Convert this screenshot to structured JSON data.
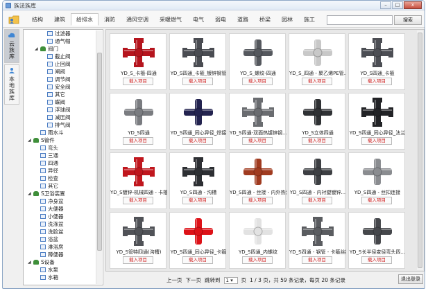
{
  "window": {
    "title": "族法族库",
    "minimize": "–",
    "maximize": "□",
    "close": "x"
  },
  "tabs": [
    "结构",
    "建筑",
    "给排水",
    "消防",
    "通风空调",
    "采暖燃气",
    "电气",
    "弱电",
    "道路",
    "桥梁",
    "园林",
    "施工"
  ],
  "active_tab": 2,
  "search": {
    "value": "",
    "placeholder": "",
    "button_label": "搜索"
  },
  "side_nav": [
    {
      "label": [
        "云",
        "族",
        "库"
      ],
      "active": true
    },
    {
      "label": [
        "本",
        "地",
        "族",
        "库"
      ],
      "active": false
    }
  ],
  "tree": [
    {
      "label": "过滤器",
      "level": 3,
      "type": "leaf",
      "expander": ""
    },
    {
      "label": "通气帽",
      "level": 3,
      "type": "leaf",
      "expander": ""
    },
    {
      "label": "阀门",
      "level": 2,
      "type": "folder",
      "expander": "◢"
    },
    {
      "label": "截止阀",
      "level": 3,
      "type": "leaf",
      "expander": ""
    },
    {
      "label": "止回阀",
      "level": 3,
      "type": "leaf",
      "expander": ""
    },
    {
      "label": "闸阀",
      "level": 3,
      "type": "leaf",
      "expander": ""
    },
    {
      "label": "调节阀",
      "level": 3,
      "type": "leaf",
      "expander": ""
    },
    {
      "label": "安全阀",
      "level": 3,
      "type": "leaf",
      "expander": ""
    },
    {
      "label": "其它",
      "level": 3,
      "type": "leaf",
      "expander": ""
    },
    {
      "label": "蝶阀",
      "level": 3,
      "type": "leaf",
      "expander": ""
    },
    {
      "label": "浮球阀",
      "level": 3,
      "type": "leaf",
      "expander": ""
    },
    {
      "label": "减压阀",
      "level": 3,
      "type": "leaf",
      "expander": ""
    },
    {
      "label": "排气阀",
      "level": 3,
      "type": "leaf",
      "expander": ""
    },
    {
      "label": "雨水斗",
      "level": 2,
      "type": "leaf",
      "expander": ""
    },
    {
      "label": "S管件",
      "level": 1,
      "type": "folder",
      "expander": "◢"
    },
    {
      "label": "弯头",
      "level": 2,
      "type": "leaf",
      "expander": ""
    },
    {
      "label": "三通",
      "level": 2,
      "type": "leaf",
      "expander": ""
    },
    {
      "label": "四通",
      "level": 2,
      "type": "leaf",
      "expander": ""
    },
    {
      "label": "异径",
      "level": 2,
      "type": "leaf",
      "expander": ""
    },
    {
      "label": "检查",
      "level": 2,
      "type": "leaf",
      "expander": ""
    },
    {
      "label": "其它",
      "level": 2,
      "type": "leaf",
      "expander": ""
    },
    {
      "label": "S卫浴装置",
      "level": 1,
      "type": "folder",
      "expander": "◢"
    },
    {
      "label": "净身盆",
      "level": 2,
      "type": "leaf",
      "expander": ""
    },
    {
      "label": "大便器",
      "level": 2,
      "type": "leaf",
      "expander": ""
    },
    {
      "label": "小便器",
      "level": 2,
      "type": "leaf",
      "expander": ""
    },
    {
      "label": "洗涤盆",
      "level": 2,
      "type": "leaf",
      "expander": ""
    },
    {
      "label": "洗脸盆",
      "level": 2,
      "type": "leaf",
      "expander": ""
    },
    {
      "label": "浴盆",
      "level": 2,
      "type": "leaf",
      "expander": ""
    },
    {
      "label": "淋浴房",
      "level": 2,
      "type": "leaf",
      "expander": ""
    },
    {
      "label": "蹲便器",
      "level": 2,
      "type": "leaf",
      "expander": ""
    },
    {
      "label": "S设备",
      "level": 1,
      "type": "folder",
      "expander": "◢"
    },
    {
      "label": "水泵",
      "level": 2,
      "type": "leaf",
      "expander": ""
    },
    {
      "label": "水箱",
      "level": 2,
      "type": "leaf",
      "expander": ""
    }
  ],
  "cards": [
    {
      "name": "YD_S_卡箍-四通",
      "color": "#b5141d",
      "shape": "cross-flange"
    },
    {
      "name": "YD_S四通_卡箍_镀锌钢管",
      "color": "#4a4c52",
      "shape": "cross-flange"
    },
    {
      "name": "YD_S_螺纹-四通",
      "color": "#55585e",
      "shape": "cross"
    },
    {
      "name": "YD_S_四通 - 聚乙烯PE管...",
      "color": "#c8c8c8",
      "shape": "cross"
    },
    {
      "name": "YD_S四通_卡箍",
      "color": "#4c4e54",
      "shape": "cross-flange"
    },
    {
      "name": "YD_S四通",
      "color": "#7a7c80",
      "shape": "cross"
    },
    {
      "name": "YD_S四通_同心异径_焊接",
      "color": "#23234f",
      "shape": "cross"
    },
    {
      "name": "YD_S四通-双面热镀锌钢...",
      "color": "#6a6c70",
      "shape": "cross-flange"
    },
    {
      "name": "YD_S立体四通",
      "color": "#2f3134",
      "shape": "cross"
    },
    {
      "name": "YD_S四通_同心异径_法兰",
      "color": "#222326",
      "shape": "cross-flange"
    },
    {
      "name": "YD_S镀锌-机械四通 - 卡箍...",
      "color": "#c0161d",
      "shape": "cross-flange"
    },
    {
      "name": "YD_S四通 - 沟槽",
      "color": "#2d2f33",
      "shape": "cross-flange"
    },
    {
      "name": "YD_S四通 - 丝接 - 内外热浸...",
      "color": "#a03b20",
      "shape": "cross"
    },
    {
      "name": "YD_S四通 - 内衬塑镀锌...",
      "color": "#3d3f43",
      "shape": "cross"
    },
    {
      "name": "YD_S四通 - 丝扣连接",
      "color": "#8a8c90",
      "shape": "cross"
    },
    {
      "name": "YD_S管特四通(沟槽)",
      "color": "#505257",
      "shape": "cross-flange"
    },
    {
      "name": "YD_S四通_同心异径_卡箍",
      "color": "#dd1218",
      "shape": "cross"
    },
    {
      "name": "YD_S四通_内螺纹",
      "color": "#e2e2e2",
      "shape": "cross"
    },
    {
      "name": "YD_S四通 - 钢管 - 卡箍丝扣",
      "color": "#5a5c60",
      "shape": "cross-flange"
    },
    {
      "name": "YD_S长半径变径弯头四...",
      "color": "#45474b",
      "shape": "cross"
    }
  ],
  "load_label": "载入项目",
  "pager": {
    "prev": "上一页",
    "next": "下一页",
    "jump": "跳转到",
    "page_value": "1",
    "page_unit": "页",
    "progress": "1 / 3 页，共 59 条记录，每页 20 条记录"
  },
  "exit_label": "退出登录"
}
